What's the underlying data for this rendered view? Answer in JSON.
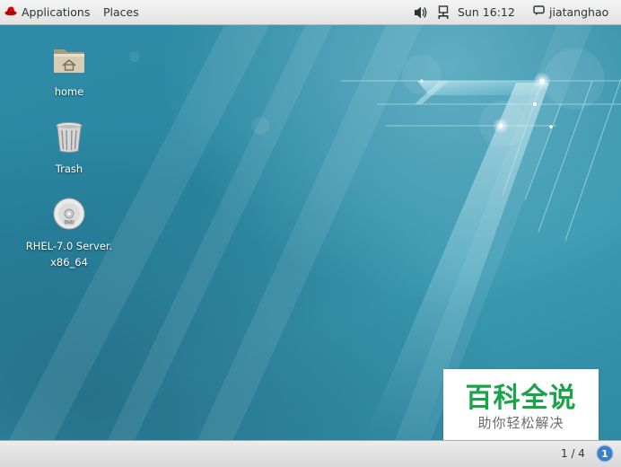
{
  "topbar": {
    "applications_label": "Applications",
    "places_label": "Places",
    "clock": "Sun 16:12",
    "username": "jiatanghao"
  },
  "desktop": {
    "icons": [
      {
        "label": "home",
        "icon": "home-folder-icon"
      },
      {
        "label": "Trash",
        "icon": "trash-icon"
      },
      {
        "label_line1": "RHEL-7.0 Server.",
        "label_line2": "x86_64",
        "icon": "dvd-icon"
      }
    ]
  },
  "watermark": {
    "title": "百科全说",
    "subtitle": "助你轻松解决"
  },
  "bottombar": {
    "workspace": "1 / 4",
    "notification_count": "1"
  },
  "colors": {
    "desktop_base": "#2f8aa6",
    "topbar_bg": "#e9e9e9",
    "watermark_green": "#1aa34a",
    "notification_blue": "#3b7fc4"
  }
}
